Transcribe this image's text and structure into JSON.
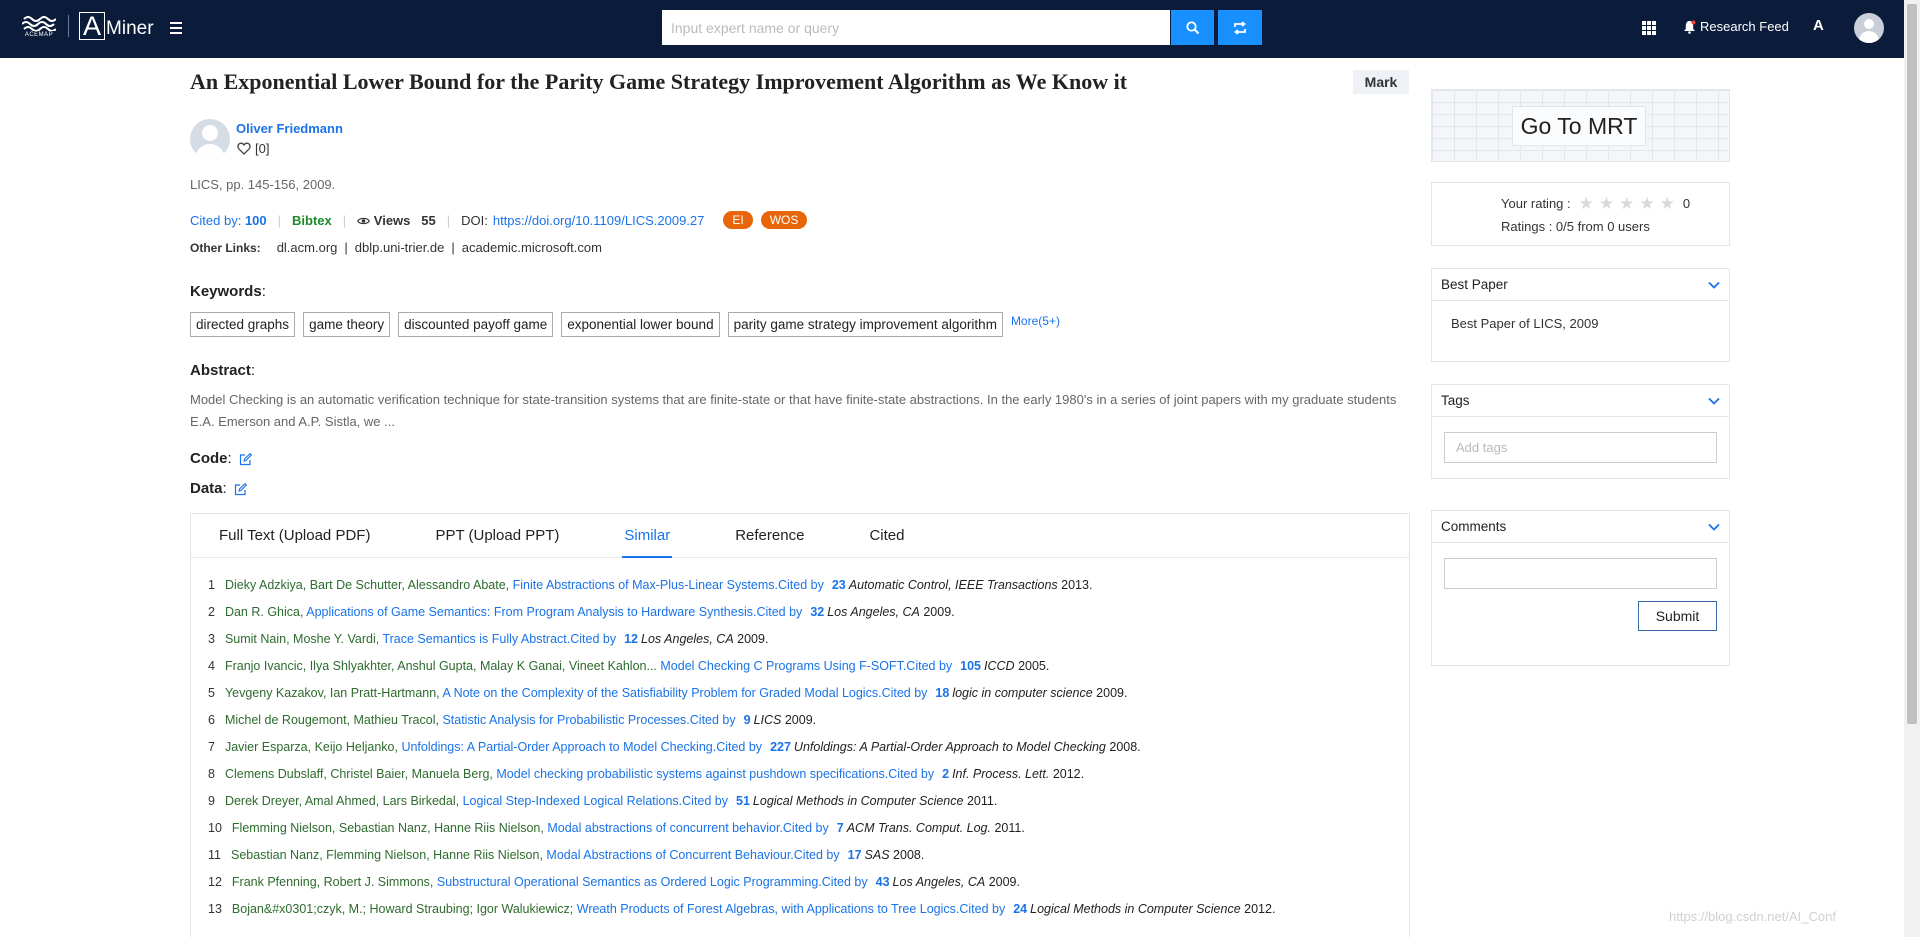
{
  "header": {
    "logo_text": "ACEMAP",
    "brand_letter": "A",
    "brand_rest": "Miner",
    "search_placeholder": "Input expert name or query",
    "research_feed": "Research Feed",
    "lang_label": "A"
  },
  "paper": {
    "title": "An Exponential Lower Bound for the Parity Game Strategy Improvement Algorithm as We Know it",
    "mark_label": "Mark",
    "author": "Oliver Friedmann",
    "likes": "[0]",
    "venue": "LICS, pp. 145-156, 2009.",
    "cited_label": "Cited by:",
    "cited_count": "100",
    "bibtex": "Bibtex",
    "views_label": "Views",
    "views_count": "55",
    "doi_label": "DOI:",
    "doi": "https://doi.org/10.1109/LICS.2009.27",
    "badges": [
      "EI",
      "WOS"
    ],
    "other_links_label": "Other Links:",
    "other_links": [
      "dl.acm.org",
      "dblp.uni-trier.de",
      "academic.microsoft.com"
    ],
    "keywords_label": "Keywords",
    "keywords": [
      "directed graphs",
      "game theory",
      "discounted payoff game",
      "exponential lower bound",
      "parity game strategy improvement algorithm"
    ],
    "keywords_more": "More(5+)",
    "abstract_label": "Abstract",
    "abstract": "Model Checking is an automatic verification technique for state-transition systems that are finite-state or that have finite-state abstractions. In the early 1980's in a series of joint papers with my graduate students E.A. Emerson and A.P. Sistla, we ...",
    "code_label": "Code",
    "data_label": "Data"
  },
  "tabs": [
    {
      "label": "Full Text (Upload PDF)"
    },
    {
      "label": "PPT (Upload PPT)"
    },
    {
      "label": "Similar"
    },
    {
      "label": "Reference"
    },
    {
      "label": "Cited"
    }
  ],
  "active_tab": "Similar",
  "similar": [
    {
      "n": "1",
      "authors": "Dieky Adzkiya, Bart De Schutter, Alessandro Abate,",
      "title": "Finite Abstractions of Max-Plus-Linear Systems.",
      "cited_by": "Cited by",
      "count": "23",
      "venue": "Automatic Control, IEEE Transactions",
      "year": "2013."
    },
    {
      "n": "2",
      "authors": "Dan R. Ghica,",
      "title": "Applications of Game Semantics: From Program Analysis to Hardware Synthesis.",
      "cited_by": "Cited by",
      "count": "32",
      "venue": "Los Angeles, CA",
      "year": "2009."
    },
    {
      "n": "3",
      "authors": "Sumit Nain, Moshe Y. Vardi,",
      "title": "Trace Semantics is Fully Abstract.",
      "cited_by": "Cited by",
      "count": "12",
      "venue": "Los Angeles, CA",
      "year": "2009."
    },
    {
      "n": "4",
      "authors": "Franjo Ivancic, Ilya Shlyakhter, Anshul Gupta, Malay K Ganai, Vineet Kahlon...",
      "title": "Model Checking C Programs Using F-SOFT.",
      "cited_by": "Cited by",
      "count": "105",
      "venue": "ICCD",
      "year": "2005."
    },
    {
      "n": "5",
      "authors": "Yevgeny Kazakov, Ian Pratt-Hartmann,",
      "title": "A Note on the Complexity of the Satisfiability Problem for Graded Modal Logics.",
      "cited_by": "Cited by",
      "count": "18",
      "venue": "logic in computer science",
      "year": "2009."
    },
    {
      "n": "6",
      "authors": "Michel de Rougemont, Mathieu Tracol,",
      "title": "Statistic Analysis for Probabilistic Processes.",
      "cited_by": "Cited by",
      "count": "9",
      "venue": "LICS",
      "year": "2009."
    },
    {
      "n": "7",
      "authors": "Javier Esparza, Keijo Heljanko,",
      "title": "Unfoldings: A Partial-Order Approach to Model Checking.",
      "cited_by": "Cited by",
      "count": "227",
      "venue": "Unfoldings: A Partial-Order Approach to Model Checking",
      "year": "2008."
    },
    {
      "n": "8",
      "authors": "Clemens Dubslaff, Christel Baier, Manuela Berg,",
      "title": "Model checking probabilistic systems against pushdown specifications.",
      "cited_by": "Cited by",
      "count": "2",
      "venue": "Inf. Process. Lett.",
      "year": "2012."
    },
    {
      "n": "9",
      "authors": "Derek Dreyer, Amal Ahmed, Lars Birkedal,",
      "title": "Logical Step-Indexed Logical Relations.",
      "cited_by": "Cited by",
      "count": "51",
      "venue": "Logical Methods in Computer Science",
      "year": "2011."
    },
    {
      "n": "10",
      "authors": "Flemming Nielson, Sebastian Nanz, Hanne Riis Nielson,",
      "title": "Modal abstractions of concurrent behavior.",
      "cited_by": "Cited by",
      "count": "7",
      "venue": "ACM Trans. Comput. Log.",
      "year": "2011."
    },
    {
      "n": "11",
      "authors": "Sebastian Nanz, Flemming Nielson, Hanne Riis Nielson,",
      "title": "Modal Abstractions of Concurrent Behaviour.",
      "cited_by": "Cited by",
      "count": "17",
      "venue": "SAS",
      "year": "2008."
    },
    {
      "n": "12",
      "authors": "Frank Pfenning, Robert J. Simmons,",
      "title": "Substructural Operational Semantics as Ordered Logic Programming.",
      "cited_by": "Cited by",
      "count": "43",
      "venue": "Los Angeles, CA",
      "year": "2009."
    },
    {
      "n": "13",
      "authors": "Bojan&#x0301;czyk, M.; Howard Straubing; Igor Walukiewicz;",
      "title": "Wreath Products of Forest Algebras, with Applications to Tree Logics.",
      "cited_by": "Cited by",
      "count": "24",
      "venue": "Logical Methods in Computer Science",
      "year": "2012."
    }
  ],
  "sidebar": {
    "mrt_label": "Go To MRT",
    "rating_label": "Your rating :",
    "rating_value": "0",
    "stars_total": 5,
    "stars_filled": 0,
    "ratings_summary": "Ratings : 0/5 from 0 users",
    "best_paper_title": "Best Paper",
    "best_paper_text": "Best Paper of LICS, 2009",
    "tags_title": "Tags",
    "tags_placeholder": "Add tags",
    "comments_title": "Comments",
    "submit_label": "Submit"
  },
  "watermark": "https://blog.csdn.net/AI_Conf",
  "colors": {
    "topbar": "#0b1c3a",
    "accent": "#1890ff",
    "link": "#1a73e8",
    "author_green": "#2e6b2e",
    "badge_orange": "#e8650a"
  }
}
